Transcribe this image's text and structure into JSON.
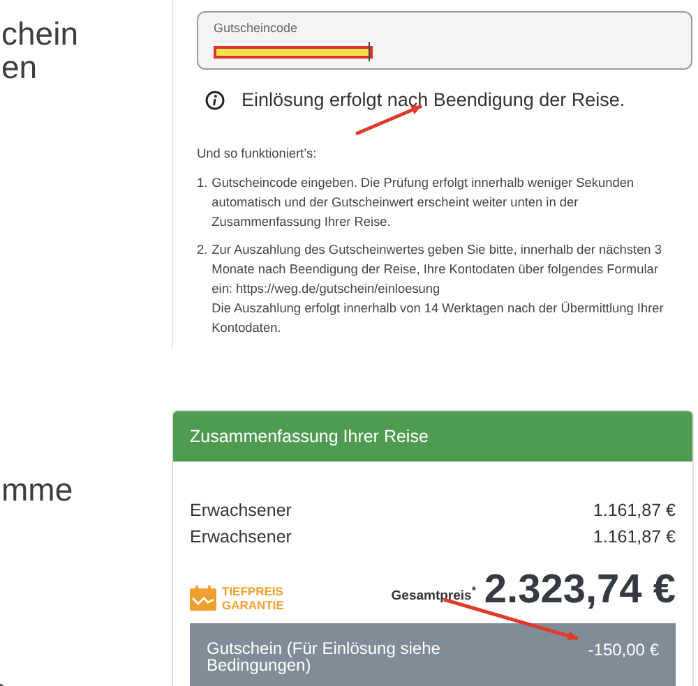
{
  "voucher_section": {
    "heading_lines": [
      "chein",
      "en"
    ],
    "field": {
      "label": "Gutscheincode",
      "redacted": true
    },
    "info": "Einlösung erfolgt nach Beendigung der Reise.",
    "how_to": {
      "title": "Und so funktioniert’s:",
      "steps": [
        {
          "number": "1.",
          "lines": [
            "Gutscheincode eingeben. Die Prüfung erfolgt innerhalb weniger Sekunden automatisch und der Gutscheinwert erscheint weiter unten in der Zusammenfassung Ihrer Reise."
          ]
        },
        {
          "number": "2.",
          "lines": [
            "Zur Auszahlung des Gutscheinwertes geben Sie bitte, innerhalb der nächsten 3 Monate nach Beendigung der Reise, Ihre Kontodaten über folgendes Formular ein: https://weg.de/gutschein/einloesung",
            "Die Auszahlung erfolgt innerhalb von 14 Werktagen nach der Übermittlung Ihrer Kontodaten."
          ]
        }
      ]
    }
  },
  "total_section": {
    "heading": "mme",
    "summary": {
      "title": "Zusammenfassung Ihrer Reise",
      "rows": [
        {
          "label": "Erwachsener",
          "amount": "1.161,87 €"
        },
        {
          "label": "Erwachsener",
          "amount": "1.161,87 €"
        }
      ],
      "guarantee": [
        "TIEFPREIS",
        "GARANTIE"
      ],
      "total_label": "Gesamtpreis$^{*}$",
      "total": "2.323,74 €",
      "voucher": {
        "label": "Gutschein (Für Einlösung siehe Bedingungen)",
        "amount": "-150,00 €"
      }
    }
  }
}
